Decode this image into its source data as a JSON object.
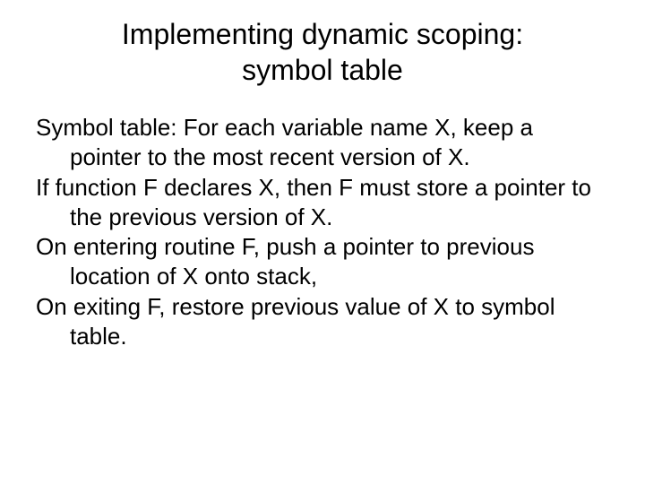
{
  "slide": {
    "title_line1": "Implementing dynamic scoping:",
    "title_line2": "symbol table",
    "para1": "Symbol table: For each variable name X, keep a pointer to the most recent version of X.",
    "para2": "If function F declares X, then F must store a pointer to the previous version of X.",
    "para3": "On entering routine F, push a pointer to previous location of X onto stack,",
    "para4": "On exiting F, restore previous value of X to symbol table."
  }
}
